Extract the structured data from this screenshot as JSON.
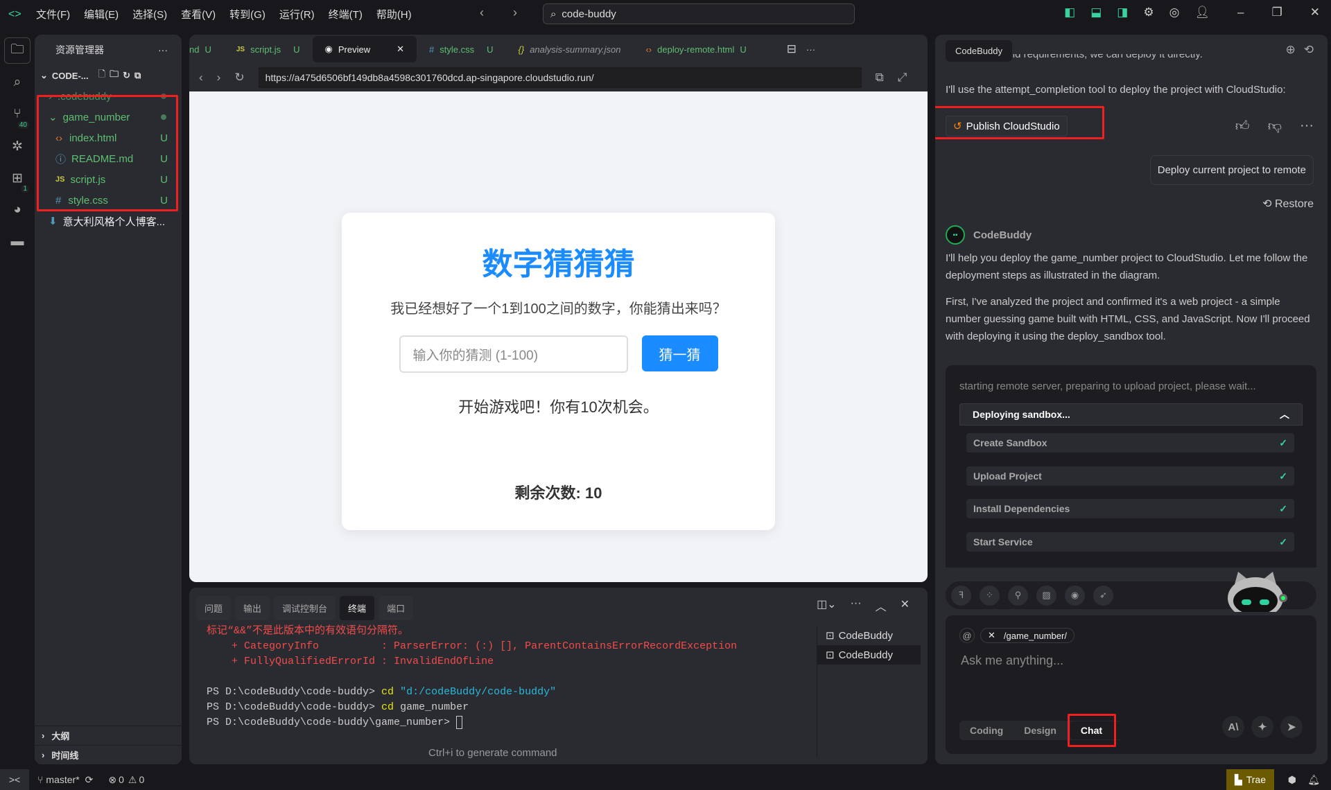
{
  "titlebar": {
    "menu": [
      "文件(F)",
      "编辑(E)",
      "选择(S)",
      "查看(V)",
      "转到(G)",
      "运行(R)",
      "终端(T)",
      "帮助(H)"
    ],
    "search": "code-buddy"
  },
  "activity": {
    "scm_badge": "40",
    "ext_badge": "1"
  },
  "explorer": {
    "title": "资源管理器",
    "project": "CODE-...",
    "items": [
      {
        "name": ".codebuddy",
        "status": ""
      },
      {
        "name": "game_number",
        "status": ""
      },
      {
        "name": "index.html",
        "status": "U"
      },
      {
        "name": "README.md",
        "status": "U"
      },
      {
        "name": "script.js",
        "status": "U"
      },
      {
        "name": "style.css",
        "status": "U"
      },
      {
        "name": "意大利风格个人博客...",
        "status": ""
      }
    ],
    "outline": "大纲",
    "timeline": "时间线"
  },
  "editor": {
    "tabs": [
      {
        "label": "nd",
        "status": "U"
      },
      {
        "label": "script.js",
        "status": "U"
      },
      {
        "label": "Preview",
        "status": ""
      },
      {
        "label": "style.css",
        "status": "U"
      },
      {
        "label": "analysis-summary.json",
        "status": ""
      },
      {
        "label": "deploy-remote.html",
        "status": "U"
      }
    ],
    "url": "https://a475d6506bf149db8a4598c301760dcd.ap-singapore.cloudstudio.run/"
  },
  "game": {
    "title": "数字猜猜猜",
    "desc": "我已经想好了一个1到100之间的数字，你能猜出来吗？",
    "placeholder": "输入你的猜测 (1-100)",
    "button": "猜一猜",
    "message": "开始游戏吧！你有10次机会。",
    "remaining": "剩余次数: 10"
  },
  "terminal": {
    "tabs": [
      "问题",
      "输出",
      "调试控制台",
      "终端",
      "端口"
    ],
    "lines": [
      "标记“&&”不是此版本中的有效语句分隔符。",
      "    + CategoryInfo          : ParserError: (:) [], ParentContainsErrorRecordException",
      "    + FullyQualifiedErrorId : InvalidEndOfLine"
    ],
    "prompt1": "PS D:\\codeBuddy\\code-buddy> ",
    "cmd1": "cd",
    "arg1": " \"d:/codeBuddy/code-buddy\"",
    "prompt2": "PS D:\\codeBuddy\\code-buddy> ",
    "cmd2": "cd",
    "arg2": " game_number",
    "prompt3": "PS D:\\codeBuddy\\code-buddy\\game_number> ",
    "sessions": [
      "CodeBuddy",
      "CodeBuddy"
    ],
    "hint": "Ctrl+i to generate command"
  },
  "chat": {
    "tab": "CodeBuddy",
    "cut_text": "with no backend requirements, we can deploy it directly.",
    "msg1": "I'll use the attempt_completion tool to deploy the project with CloudStudio:",
    "publish": "Publish CloudStudio",
    "user_msg": "Deploy current project to remote",
    "restore": "Restore",
    "bot": "CodeBuddy",
    "p1": "I'll help you deploy the game_number project to CloudStudio. Let me follow the deployment steps as illustrated in the diagram.",
    "p2": "First, I've analyzed the project and confirmed it's a web project - a simple number guessing game built with HTML, CSS, and JavaScript. Now I'll proceed with deploying it using the deploy_sandbox tool.",
    "deploy_status": "starting remote server, preparing to upload project, please wait...",
    "deploy_head": "Deploying sandbox...",
    "steps": [
      "Create Sandbox",
      "Upload Project",
      "Install Dependencies",
      "Start Service"
    ],
    "context": "/game_number/",
    "placeholder": "Ask me anything...",
    "modes": [
      "Coding",
      "Design",
      "Chat"
    ],
    "model": "A\\"
  },
  "status": {
    "branch": "master*",
    "errors": "0",
    "warnings": "0",
    "trae": "Trae"
  }
}
